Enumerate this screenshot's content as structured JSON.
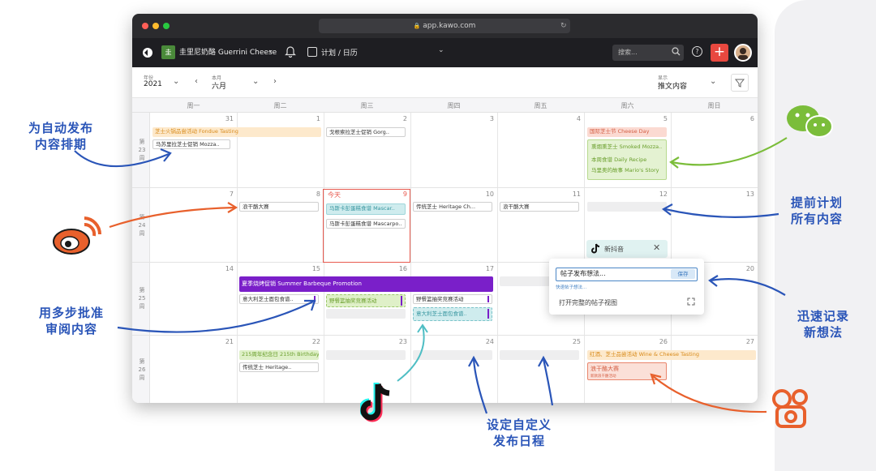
{
  "browser": {
    "url": "app.kawo.com"
  },
  "appbar": {
    "brand_name": "圭里尼奶酪 Guerrini Cheese",
    "plan_label": "计划 / 日历",
    "search_placeholder": "搜索..."
  },
  "toolbar": {
    "year_small": "年份",
    "year": "2021",
    "month_small": "本月",
    "month": "六月",
    "display_small": "显示",
    "display_value": "推文内容"
  },
  "days": [
    "周一",
    "周二",
    "周三",
    "周四",
    "周五",
    "周六",
    "周日"
  ],
  "weeks": [
    {
      "label": [
        "第",
        "23",
        "周"
      ],
      "dates": [
        "31",
        "1",
        "2",
        "3",
        "4",
        "5",
        "6"
      ]
    },
    {
      "label": [
        "第",
        "24",
        "周"
      ],
      "dates": [
        "7",
        "8",
        "9",
        "10",
        "11",
        "12",
        "13"
      ]
    },
    {
      "label": [
        "第",
        "25",
        "周"
      ],
      "dates": [
        "14",
        "15",
        "16",
        "17",
        "",
        "",
        "20"
      ]
    },
    {
      "label": [
        "第",
        "26",
        "周"
      ],
      "dates": [
        "21",
        "22",
        "23",
        "24",
        "25",
        "26",
        "27"
      ]
    }
  ],
  "today_label": "今天",
  "events": {
    "fondue": "芝士火锅品尝活动 Fondue Tasting",
    "mozza_mon": "马苏里拉芝士促销 Mozza..",
    "gorg": "戈根索拉芝士促销 Gorg..",
    "cheese_day": "国际芝士节 Cheese Day",
    "smoked": "熏烟熏芝士 Smoked Mozza..",
    "daily": "本周食谱 Daily Recipe",
    "mario": "马里奥的故事 Mario's Story",
    "dry_cheese_1": "浪干酪大赛",
    "mascar_1": "马斯卡彭蛋糕食谱 Mascar..",
    "mascar_2": "马斯卡彭蛋糕食谱 Mascarpo..",
    "heritage_1": "传统芝士 Heritage Ch...",
    "dry_cheese_2": "浪干酪大赛",
    "summer": "夏季烧烤促销 Summer Barbeque Promotion",
    "italy_1": "意大利芝士面包食谱..",
    "picnic_1": "野餐篮抽奖竞赛活动",
    "picnic_2": "野餐篮抽奖竞赛活动",
    "italy_2": "意大利芝士面包食谱..",
    "birthday": "215周年纪念日 215th Birthday",
    "heritage_2": "传统芝士 Heritage..",
    "wine": "红酒、芝士品尝活动 Wine & Cheese Tasting",
    "dry_cheese_3": "浪干酪大赛",
    "dry_cheese_3_sub": "新款浪干酪活动"
  },
  "tiktok_tab": "新抖音",
  "popup": {
    "input": "帖子发布想法...",
    "save": "保存",
    "hint": "快速帖子想法...",
    "open_full": "打开完整的帖子视图"
  },
  "annotations": {
    "auto_publish": [
      "为自动发布",
      "内容排期"
    ],
    "plan_ahead": [
      "提前计划",
      "所有内容"
    ],
    "approval": [
      "用多步批准",
      "审阅内容"
    ],
    "quick_ideas": [
      "迅速记录",
      "新想法"
    ],
    "custom_schedule": [
      "设定自定义",
      "发布日程"
    ]
  },
  "colors": {
    "annotation_blue": "#2a55b8",
    "weibo_orange": "#e8602c",
    "wechat_green": "#7bbd3a",
    "purple_event": "#7a1fc9",
    "today_red": "#e85a4f",
    "add_button": "#e8483f"
  },
  "icons": [
    "kawo-logo-icon",
    "bell-icon",
    "calendar-icon",
    "search-icon",
    "help-icon",
    "plus-icon",
    "filter-icon",
    "weibo-icon",
    "wechat-icon",
    "tiktok-icon",
    "camera-icon"
  ]
}
